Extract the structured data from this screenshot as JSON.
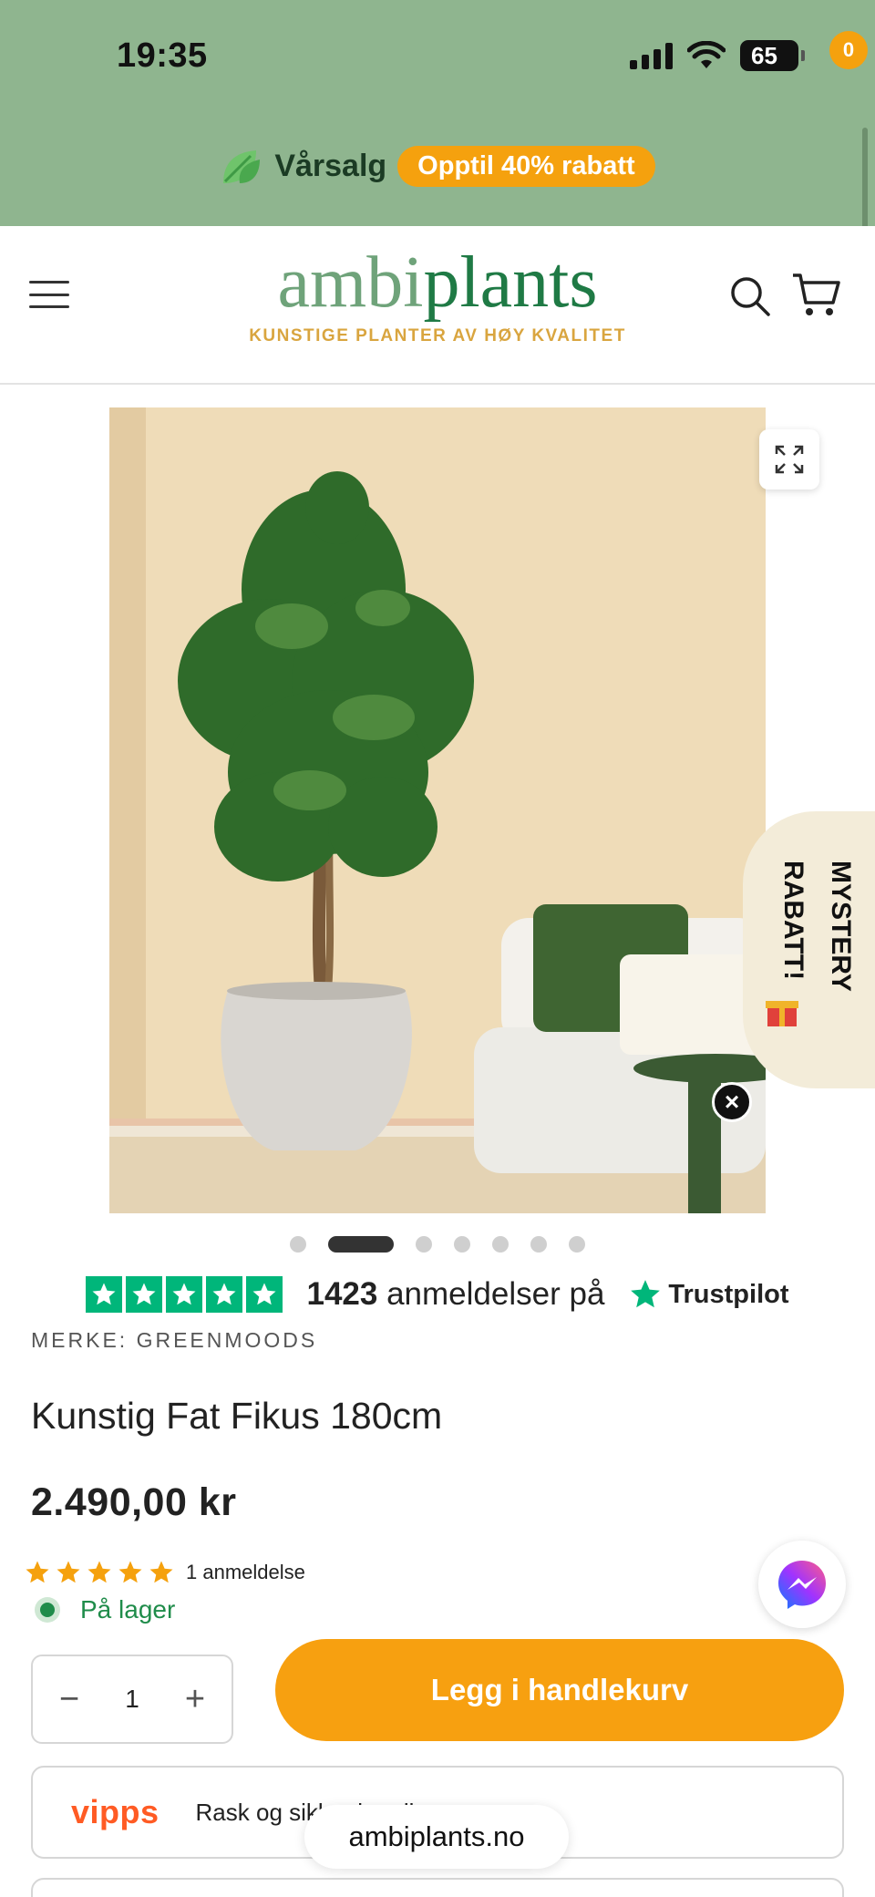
{
  "status_bar": {
    "time": "19:35",
    "battery": "65"
  },
  "promo": {
    "title": "Vårsalg",
    "badge": "Opptil 40% rabatt"
  },
  "header": {
    "logo_part1": "ambi",
    "logo_part2": "plants",
    "tagline": "KUNSTIGE PLANTER AV HØY KVALITET",
    "cart_count": "0"
  },
  "gallery": {
    "slide_count": 7,
    "active_slide": 2
  },
  "mystery": {
    "line1": "MYSTERY",
    "line2": "RABATT!"
  },
  "trustpilot": {
    "count": "1423",
    "text": "anmeldelser på",
    "brand": "Trustpilot"
  },
  "product": {
    "brand": "MERKE: GREENMOODS",
    "title": "Kunstig Fat Fikus 180cm",
    "price": "2.490,00 kr",
    "rating": 5,
    "reviews": "1 anmeldelse",
    "stock": "På lager",
    "quantity": "1",
    "add_to_cart": "Legg i handlekurv"
  },
  "vipps": {
    "logo": "vipps",
    "text": "Rask og sikker betaling"
  },
  "browser": {
    "url": "ambiplants.no"
  },
  "colors": {
    "green_band": "#8fb58f",
    "accent_orange": "#f7a010",
    "trustpilot_green": "#00b67a"
  }
}
